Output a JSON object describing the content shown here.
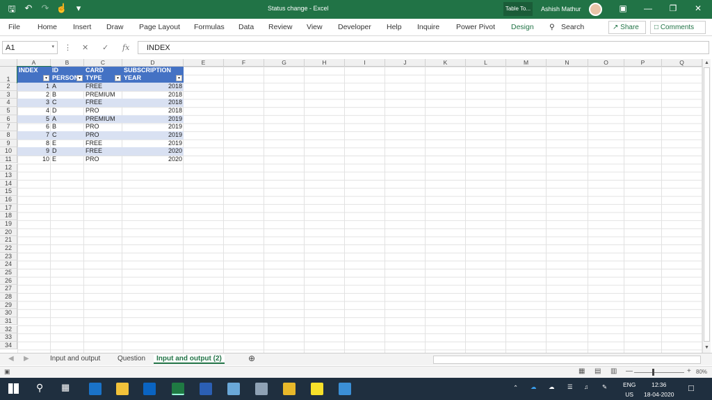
{
  "window": {
    "title": "Status change - Excel",
    "context_tab": "Table To...",
    "user": "Ashish Mathur"
  },
  "ribbon": {
    "tabs": [
      "File",
      "Home",
      "Insert",
      "Draw",
      "Page Layout",
      "Formulas",
      "Data",
      "Review",
      "View",
      "Developer",
      "Help",
      "Inquire",
      "Power Pivot",
      "Design"
    ],
    "search": "Search",
    "share": "Share",
    "comments": "Comments"
  },
  "formula_bar": {
    "name_box": "A1",
    "fx": "fx",
    "formula": "INDEX"
  },
  "columns": [
    "A",
    "B",
    "C",
    "D",
    "E",
    "F",
    "G",
    "H",
    "I",
    "J",
    "K",
    "L",
    "M",
    "N",
    "O",
    "P",
    "Q"
  ],
  "rows": [
    "1",
    "2",
    "3",
    "4",
    "5",
    "6",
    "7",
    "8",
    "9",
    "10",
    "11",
    "12",
    "13",
    "14",
    "15",
    "16",
    "17",
    "18",
    "19",
    "20",
    "21",
    "22",
    "23",
    "24",
    "25",
    "26",
    "27",
    "28",
    "29",
    "30",
    "31",
    "32",
    "33",
    "34"
  ],
  "table": {
    "headers": [
      [
        "",
        "INDEX"
      ],
      [
        "ID",
        "PERSON"
      ],
      [
        "CARD",
        "TYPE"
      ],
      [
        "SUBSCRIPTION",
        "YEAR"
      ]
    ],
    "rows": [
      [
        "1",
        "A",
        "FREE",
        "2018"
      ],
      [
        "2",
        "B",
        "PREMIUM",
        "2018"
      ],
      [
        "3",
        "C",
        "FREE",
        "2018"
      ],
      [
        "4",
        "D",
        "PRO",
        "2018"
      ],
      [
        "5",
        "A",
        "PREMIUM",
        "2019"
      ],
      [
        "6",
        "B",
        "PRO",
        "2019"
      ],
      [
        "7",
        "C",
        "PRO",
        "2019"
      ],
      [
        "8",
        "E",
        "FREE",
        "2019"
      ],
      [
        "9",
        "D",
        "FREE",
        "2020"
      ],
      [
        "10",
        "E",
        "PRO",
        "2020"
      ]
    ]
  },
  "sheets": [
    "Input and output",
    "Question",
    "Input and output (2)"
  ],
  "active_sheet_index": 2,
  "status": {
    "zoom": "80%"
  },
  "taskbar": {
    "lang": "ENG",
    "region": "US",
    "time": "12:36",
    "date": "18-04-2020"
  }
}
